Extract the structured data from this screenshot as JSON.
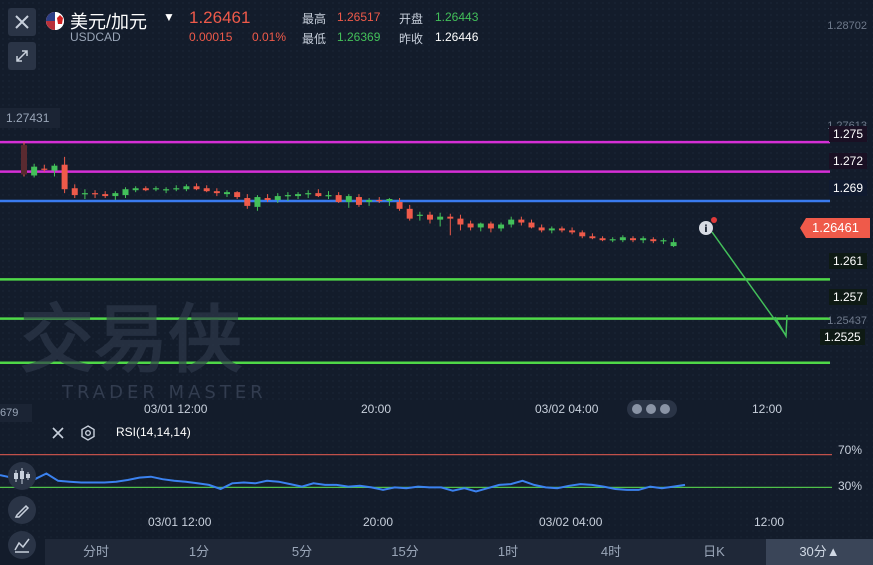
{
  "header": {
    "symbol_name": "美元/加元",
    "symbol_code": "USDCAD",
    "last_price": "1.26461",
    "change_abs": "0.00015",
    "change_pct": "0.01%",
    "high_label": "最高",
    "high_value": "1.26517",
    "open_label": "开盘",
    "open_value": "1.26443",
    "low_label": "最低",
    "low_value": "1.26369",
    "prev_close_label": "昨收",
    "prev_close_value": "1.26446"
  },
  "price_axis": {
    "ticks": [
      "1.28702",
      "1.27613",
      "1.25437"
    ],
    "left_clipped_top": "27431",
    "left_clipped_bottom": "679"
  },
  "levels": [
    {
      "label": "1.275",
      "value": 1.275,
      "color": "#d52fd6"
    },
    {
      "label": "1.272",
      "value": 1.272,
      "color": "#d52fd6"
    },
    {
      "label": "1.269",
      "value": 1.269,
      "color": "#3a7bef"
    },
    {
      "label": "1.261",
      "value": 1.261,
      "color": "#4fd848"
    },
    {
      "label": "1.257",
      "value": 1.257,
      "color": "#4fd848"
    },
    {
      "label": "1.2525",
      "value": 1.2525,
      "color": "#4fd848"
    }
  ],
  "current_price_tag": "1.26461",
  "time_axis": [
    "03/01 12:00",
    "20:00",
    "03/02 04:00",
    "12:00"
  ],
  "rsi": {
    "title": "RSI(14,14,14)",
    "upper_label": "70%",
    "lower_label": "30%",
    "upper_color": "#c0504a",
    "lower_color": "#4fc04a",
    "line_color": "#3b82f0"
  },
  "watermark": {
    "brand": "交易侠",
    "sub": "TRADER MASTER"
  },
  "timeframes": [
    {
      "label": "分时",
      "active": false
    },
    {
      "label": "1分",
      "active": false
    },
    {
      "label": "5分",
      "active": false
    },
    {
      "label": "15分",
      "active": false
    },
    {
      "label": "1时",
      "active": false
    },
    {
      "label": "4时",
      "active": false
    },
    {
      "label": "日K",
      "active": false
    },
    {
      "label": "30分▲",
      "active": true
    }
  ],
  "icons": {
    "close": "close-icon",
    "shrink": "shrink-icon",
    "flag": "usd-cad-flag-icon",
    "rsi_close": "close-icon",
    "rsi_settings": "gear-icon",
    "candles": "candlestick-icon",
    "draw": "pencil-icon",
    "indicator": "indicator-icon",
    "info": "info-icon"
  },
  "colors": {
    "up": "#43c05a",
    "down": "#ef5a4a",
    "background": "#131c2b"
  },
  "chart_data": {
    "type": "candlestick",
    "price_range": [
      1.2487,
      1.2895
    ],
    "candles": [
      {
        "o": 1.2747,
        "h": 1.275,
        "l": 1.2715,
        "c": 1.2717
      },
      {
        "o": 1.2716,
        "h": 1.2728,
        "l": 1.2714,
        "c": 1.2725
      },
      {
        "o": 1.2723,
        "h": 1.2727,
        "l": 1.272,
        "c": 1.2722
      },
      {
        "o": 1.2721,
        "h": 1.2728,
        "l": 1.2715,
        "c": 1.2726
      },
      {
        "o": 1.2727,
        "h": 1.2735,
        "l": 1.2698,
        "c": 1.2702
      },
      {
        "o": 1.2703,
        "h": 1.2707,
        "l": 1.2693,
        "c": 1.2696
      },
      {
        "o": 1.2697,
        "h": 1.2702,
        "l": 1.2692,
        "c": 1.2698
      },
      {
        "o": 1.2698,
        "h": 1.2701,
        "l": 1.2693,
        "c": 1.2697
      },
      {
        "o": 1.2697,
        "h": 1.27,
        "l": 1.2693,
        "c": 1.2695
      },
      {
        "o": 1.2695,
        "h": 1.27,
        "l": 1.2691,
        "c": 1.2698
      },
      {
        "o": 1.2696,
        "h": 1.2704,
        "l": 1.2693,
        "c": 1.2702
      },
      {
        "o": 1.2701,
        "h": 1.2705,
        "l": 1.2699,
        "c": 1.2703
      },
      {
        "o": 1.2703,
        "h": 1.2705,
        "l": 1.27,
        "c": 1.2701
      },
      {
        "o": 1.2702,
        "h": 1.2705,
        "l": 1.27,
        "c": 1.2703
      },
      {
        "o": 1.2701,
        "h": 1.2704,
        "l": 1.2698,
        "c": 1.2702
      },
      {
        "o": 1.2702,
        "h": 1.2706,
        "l": 1.27,
        "c": 1.2703
      },
      {
        "o": 1.2702,
        "h": 1.2707,
        "l": 1.27,
        "c": 1.2705
      },
      {
        "o": 1.2705,
        "h": 1.2708,
        "l": 1.2701,
        "c": 1.2702
      },
      {
        "o": 1.2703,
        "h": 1.2706,
        "l": 1.2699,
        "c": 1.27
      },
      {
        "o": 1.27,
        "h": 1.2703,
        "l": 1.2695,
        "c": 1.2698
      },
      {
        "o": 1.2697,
        "h": 1.2701,
        "l": 1.2694,
        "c": 1.2699
      },
      {
        "o": 1.2699,
        "h": 1.27,
        "l": 1.2692,
        "c": 1.2694
      },
      {
        "o": 1.2693,
        "h": 1.2697,
        "l": 1.2682,
        "c": 1.2685
      },
      {
        "o": 1.2684,
        "h": 1.2696,
        "l": 1.268,
        "c": 1.2694
      },
      {
        "o": 1.2693,
        "h": 1.2697,
        "l": 1.2689,
        "c": 1.2691
      },
      {
        "o": 1.2691,
        "h": 1.2698,
        "l": 1.2688,
        "c": 1.2695
      },
      {
        "o": 1.2695,
        "h": 1.2699,
        "l": 1.269,
        "c": 1.2696
      },
      {
        "o": 1.2695,
        "h": 1.2699,
        "l": 1.2692,
        "c": 1.2697
      },
      {
        "o": 1.2697,
        "h": 1.2701,
        "l": 1.2693,
        "c": 1.2698
      },
      {
        "o": 1.2698,
        "h": 1.2702,
        "l": 1.2694,
        "c": 1.2695
      },
      {
        "o": 1.2695,
        "h": 1.27,
        "l": 1.2692,
        "c": 1.2696
      },
      {
        "o": 1.2696,
        "h": 1.2699,
        "l": 1.2688,
        "c": 1.2689
      },
      {
        "o": 1.2689,
        "h": 1.2697,
        "l": 1.2683,
        "c": 1.2695
      },
      {
        "o": 1.2694,
        "h": 1.2697,
        "l": 1.2684,
        "c": 1.2686
      },
      {
        "o": 1.2689,
        "h": 1.2693,
        "l": 1.2685,
        "c": 1.2691
      },
      {
        "o": 1.2691,
        "h": 1.2694,
        "l": 1.2688,
        "c": 1.269
      },
      {
        "o": 1.269,
        "h": 1.2693,
        "l": 1.2685,
        "c": 1.2692
      },
      {
        "o": 1.2689,
        "h": 1.2693,
        "l": 1.268,
        "c": 1.2682
      },
      {
        "o": 1.2682,
        "h": 1.2686,
        "l": 1.267,
        "c": 1.2672
      },
      {
        "o": 1.2675,
        "h": 1.2679,
        "l": 1.267,
        "c": 1.2676
      },
      {
        "o": 1.2676,
        "h": 1.2679,
        "l": 1.2667,
        "c": 1.2671
      },
      {
        "o": 1.2671,
        "h": 1.2678,
        "l": 1.2664,
        "c": 1.2674
      },
      {
        "o": 1.2674,
        "h": 1.2677,
        "l": 1.2655,
        "c": 1.2672
      },
      {
        "o": 1.2672,
        "h": 1.2676,
        "l": 1.266,
        "c": 1.2666
      },
      {
        "o": 1.2667,
        "h": 1.267,
        "l": 1.266,
        "c": 1.2663
      },
      {
        "o": 1.2663,
        "h": 1.2668,
        "l": 1.2659,
        "c": 1.2667
      },
      {
        "o": 1.2667,
        "h": 1.2669,
        "l": 1.2658,
        "c": 1.2662
      },
      {
        "o": 1.2662,
        "h": 1.2668,
        "l": 1.2659,
        "c": 1.2666
      },
      {
        "o": 1.2666,
        "h": 1.2674,
        "l": 1.2663,
        "c": 1.2671
      },
      {
        "o": 1.2671,
        "h": 1.2674,
        "l": 1.2665,
        "c": 1.2668
      },
      {
        "o": 1.2668,
        "h": 1.2671,
        "l": 1.2662,
        "c": 1.2663
      },
      {
        "o": 1.2663,
        "h": 1.2666,
        "l": 1.2658,
        "c": 1.266
      },
      {
        "o": 1.266,
        "h": 1.2664,
        "l": 1.2657,
        "c": 1.2662
      },
      {
        "o": 1.2662,
        "h": 1.2664,
        "l": 1.2658,
        "c": 1.266
      },
      {
        "o": 1.266,
        "h": 1.2663,
        "l": 1.2656,
        "c": 1.2658
      },
      {
        "o": 1.2658,
        "h": 1.266,
        "l": 1.2652,
        "c": 1.2654
      },
      {
        "o": 1.2654,
        "h": 1.2657,
        "l": 1.2651,
        "c": 1.2652
      },
      {
        "o": 1.2652,
        "h": 1.2654,
        "l": 1.2649,
        "c": 1.265
      },
      {
        "o": 1.265,
        "h": 1.2653,
        "l": 1.2648,
        "c": 1.2651
      },
      {
        "o": 1.265,
        "h": 1.2655,
        "l": 1.2648,
        "c": 1.2653
      },
      {
        "o": 1.2652,
        "h": 1.2654,
        "l": 1.2648,
        "c": 1.265
      },
      {
        "o": 1.265,
        "h": 1.2654,
        "l": 1.2647,
        "c": 1.2652
      },
      {
        "o": 1.2651,
        "h": 1.2653,
        "l": 1.2647,
        "c": 1.2649
      },
      {
        "o": 1.2649,
        "h": 1.2652,
        "l": 1.2646,
        "c": 1.265
      },
      {
        "o": 1.2644,
        "h": 1.2652,
        "l": 1.2643,
        "c": 1.2648
      }
    ],
    "rsi_values": [
      45,
      42,
      48,
      40,
      47,
      38,
      37,
      36,
      36,
      36,
      37,
      39,
      42,
      43,
      40,
      38,
      37,
      35,
      33,
      28,
      35,
      36,
      35,
      38,
      37,
      34,
      31,
      35,
      33,
      33,
      31,
      32,
      30,
      27,
      30,
      29,
      31,
      30,
      30,
      26,
      29,
      25,
      29,
      33,
      34,
      38,
      33,
      30,
      29,
      32,
      34,
      33,
      31,
      28,
      27,
      27,
      31,
      29,
      31,
      33
    ],
    "rsi_range": [
      0,
      100
    ]
  }
}
